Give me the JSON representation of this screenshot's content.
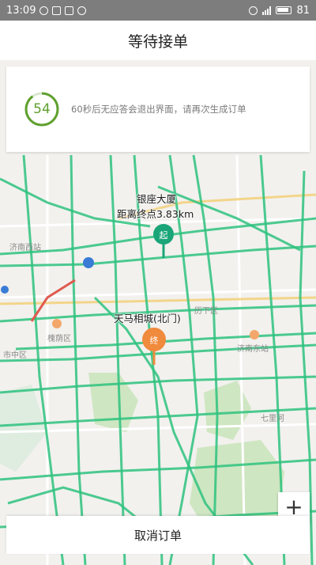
{
  "status_bar": {
    "time": "13:09",
    "battery": "81"
  },
  "header": {
    "title": "等待接单"
  },
  "wait_card": {
    "countdown": "54",
    "hint": "60秒后无应答会退出界面，请再次生成订单"
  },
  "map": {
    "start_marker": {
      "title": "银座大厦",
      "distance": "距离终点3.83km",
      "letter": "起"
    },
    "end_marker": {
      "title": "天马相城(北门)",
      "letter": "终"
    },
    "pois": [
      "济南西站",
      "槐荫区",
      "市中区",
      "历下区",
      "济南东站",
      "七里河"
    ]
  },
  "zoom": {
    "plus_label": "+"
  },
  "cancel_button": {
    "label": "取消订单"
  },
  "colors": {
    "road_green": "#2ec27e",
    "start_pin": "#1aa578",
    "end_pin": "#f08a3c",
    "timer_ring": "#5fa02e"
  }
}
